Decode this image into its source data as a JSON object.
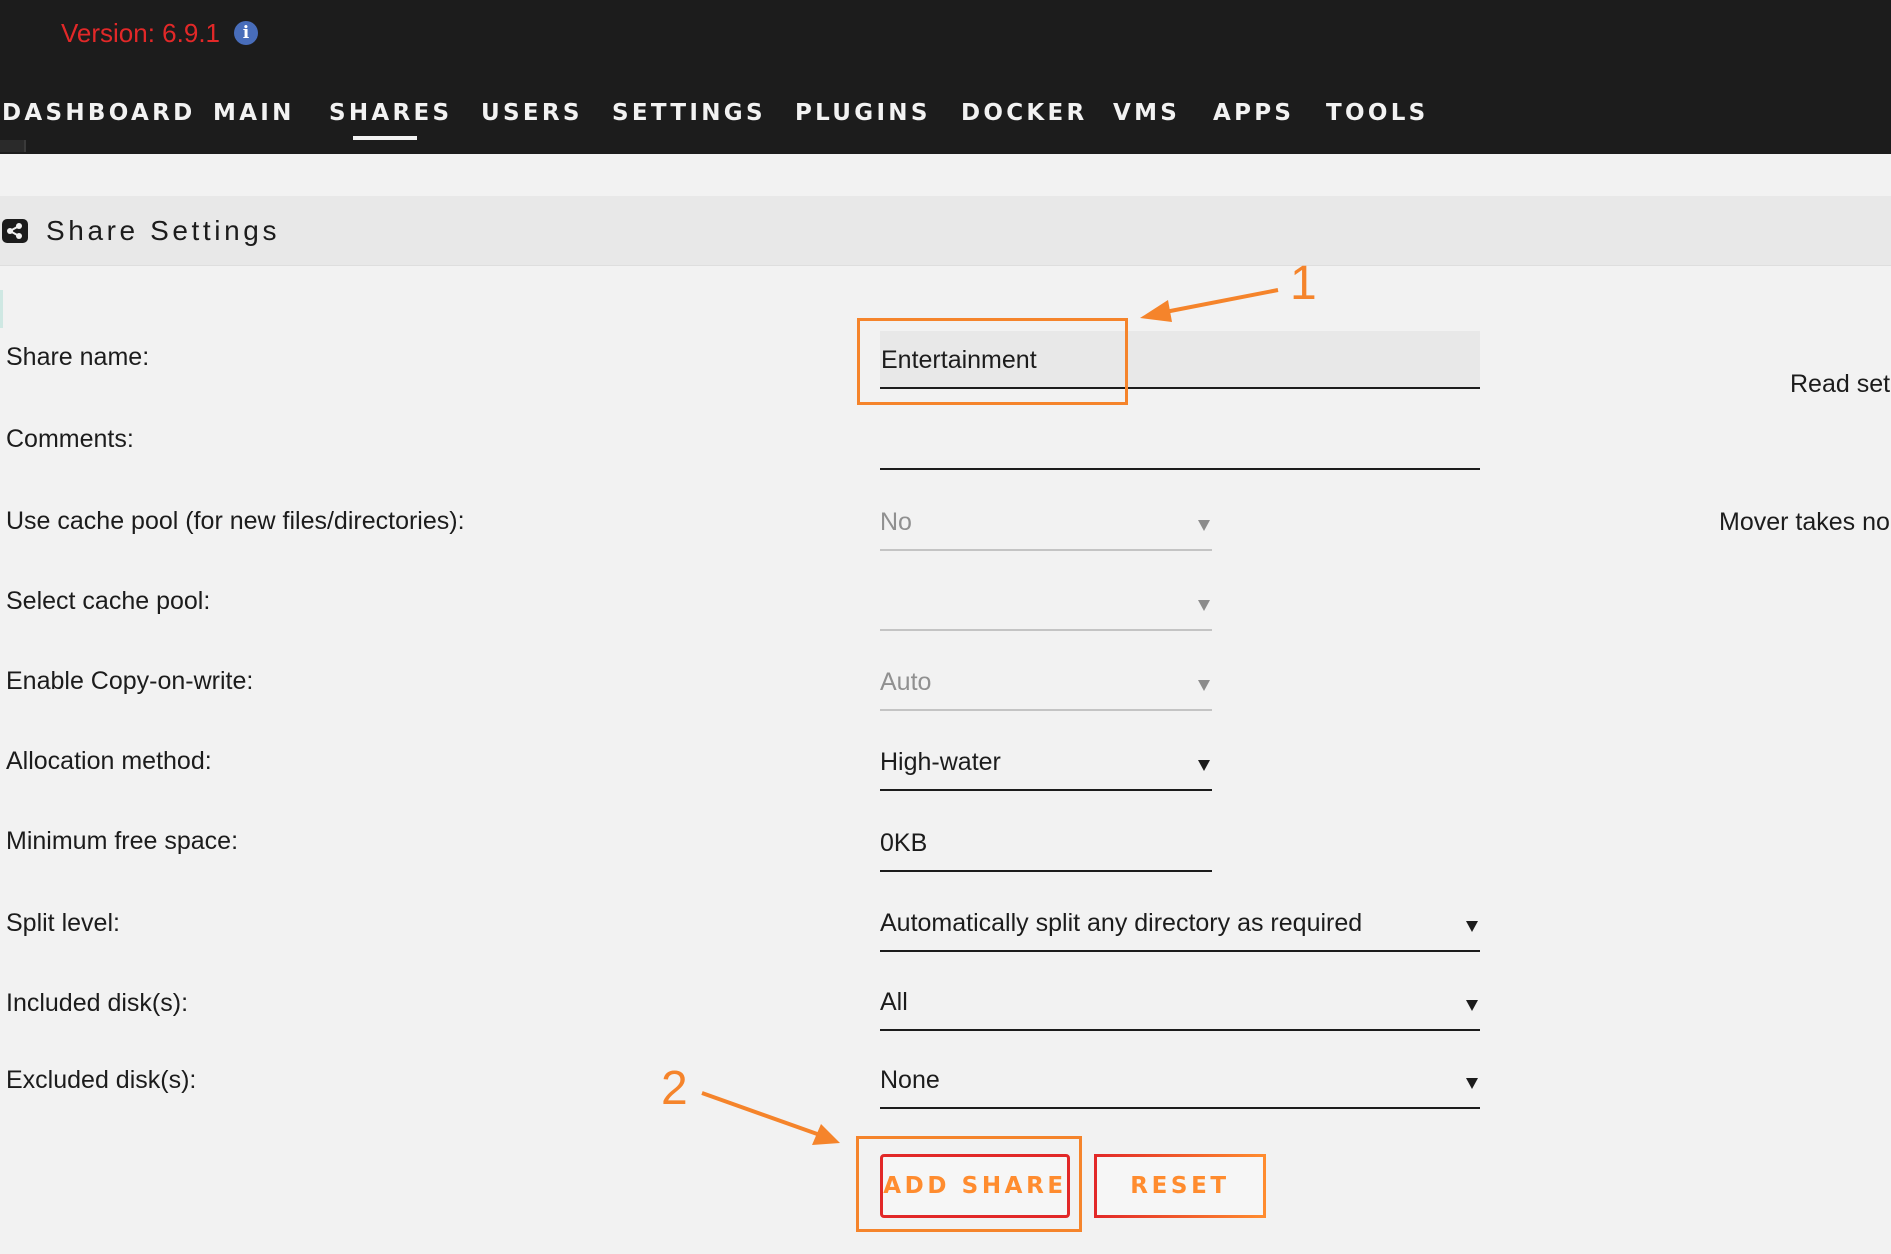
{
  "header": {
    "version": "Version: 6.9.1",
    "nav": [
      {
        "label": "DASHBOARD",
        "active": false
      },
      {
        "label": "MAIN",
        "active": false
      },
      {
        "label": "SHARES",
        "active": true
      },
      {
        "label": "USERS",
        "active": false
      },
      {
        "label": "SETTINGS",
        "active": false
      },
      {
        "label": "PLUGINS",
        "active": false
      },
      {
        "label": "DOCKER",
        "active": false
      },
      {
        "label": "VMS",
        "active": false
      },
      {
        "label": "APPS",
        "active": false
      },
      {
        "label": "TOOLS",
        "active": false
      }
    ]
  },
  "section": {
    "title": "Share Settings",
    "icon": "share-icon"
  },
  "form": {
    "share_name": {
      "label": "Share name:",
      "value": "Entertainment"
    },
    "comments": {
      "label": "Comments:",
      "value": ""
    },
    "use_cache": {
      "label": "Use cache pool (for new files/directories):",
      "value": "No"
    },
    "select_cache": {
      "label": "Select cache pool:",
      "value": ""
    },
    "copy_on_write": {
      "label": "Enable Copy-on-write:",
      "value": "Auto"
    },
    "allocation": {
      "label": "Allocation method:",
      "value": "High-water"
    },
    "min_free": {
      "label": "Minimum free space:",
      "value": "0KB"
    },
    "split_level": {
      "label": "Split level:",
      "value": "Automatically split any directory as required"
    },
    "included": {
      "label": "Included disk(s):",
      "value": "All"
    },
    "excluded": {
      "label": "Excluded disk(s):",
      "value": "None"
    }
  },
  "side_text": {
    "read_settings": "Read set",
    "mover": "Mover takes no"
  },
  "buttons": {
    "add_share": "ADD SHARE",
    "reset": "RESET"
  },
  "annotations": {
    "step1": "1",
    "step2": "2"
  },
  "colors": {
    "header_bg": "#1c1c1c",
    "version_red": "#e22828",
    "accent_orange": "#ff8c2f",
    "annotation_orange": "#f5842b"
  }
}
